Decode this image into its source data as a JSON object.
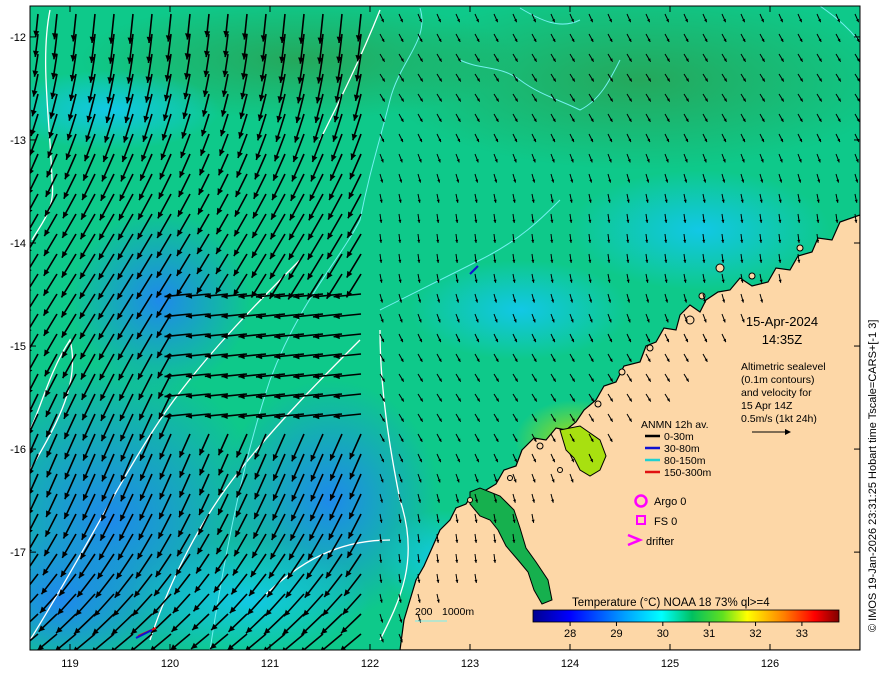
{
  "date": "15-Apr-2024",
  "time": "14:35Z",
  "altimetry_note": [
    "Altimetric sealevel",
    "(0.1m contours)",
    "and velocity for",
    "15 Apr 14Z",
    "0.5m/s (1kt 24h)"
  ],
  "mooring_legend": {
    "title": "ANMN 12h av.",
    "items": [
      {
        "label": "0-30m",
        "color": "#000000"
      },
      {
        "label": "30-80m",
        "color": "#1010d0"
      },
      {
        "label": "80-150m",
        "color": "#20d0d0"
      },
      {
        "label": "150-300m",
        "color": "#e01010"
      }
    ]
  },
  "platforms": [
    {
      "label": "Argo 0",
      "symbol": "circle-icon",
      "color": "#ff00ff"
    },
    {
      "label": "FS 0",
      "symbol": "square-icon",
      "color": "#ff00ff"
    },
    {
      "label": "drifter",
      "symbol": "chevron-icon",
      "color": "#ff00ff"
    }
  ],
  "depth_legend": {
    "label1": "200",
    "label2": "1000m"
  },
  "colorbar": {
    "title": "Temperature (°C) NOAA 18 73% ql>=4",
    "range": [
      27.2,
      33.8
    ],
    "ticks": [
      28,
      29,
      30,
      31,
      32,
      33
    ]
  },
  "credit": "© IMOS 19-Jan-2026 23:31:25 Hobart time Tscale=CARS+[-1 3]",
  "map": {
    "lon_range": [
      118.6,
      126.9
    ],
    "lat_range": [
      -17.95,
      -11.7
    ],
    "lon_ticks": [
      119,
      120,
      121,
      122,
      123,
      124,
      125,
      126
    ],
    "lat_ticks": [
      -12,
      -13,
      -14,
      -15,
      -16,
      -17
    ],
    "land_color": "#fdd7a7",
    "sea_colors": [
      "#0090ff",
      "#00c8ff",
      "#00d488",
      "#16b04e",
      "#8fd400"
    ]
  }
}
